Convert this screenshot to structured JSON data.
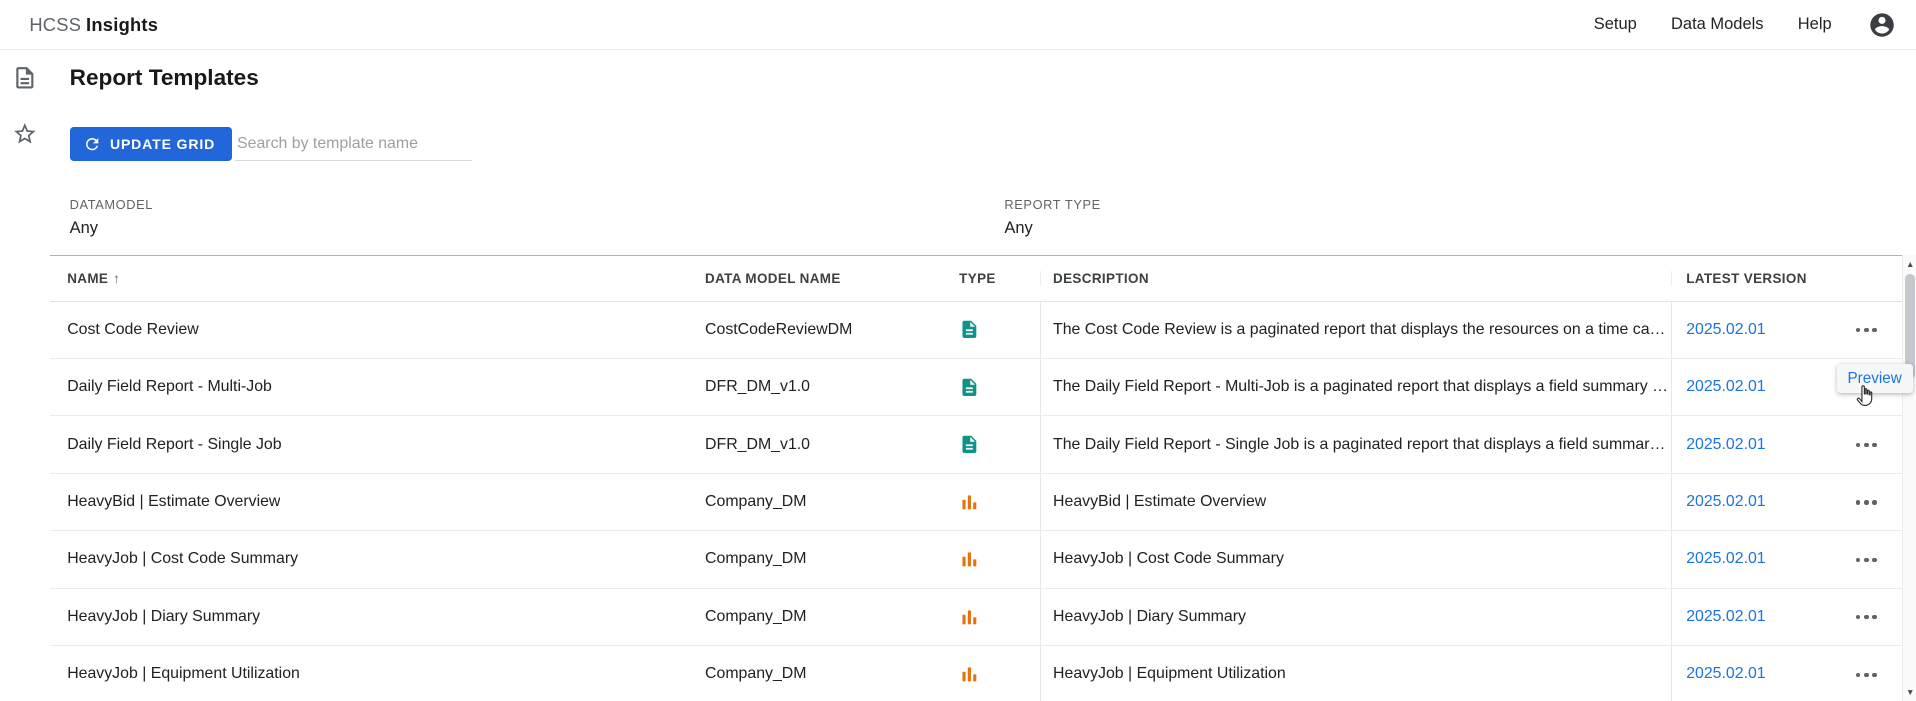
{
  "colors": {
    "primary_button": "#2167d9",
    "link": "#1a73e8",
    "report_icon": "#0d9488",
    "chart_icon": "#e8710a"
  },
  "header": {
    "brand_prefix": "HCSS",
    "brand_bold": "Insights",
    "nav": [
      {
        "label": "Setup"
      },
      {
        "label": "Data Models"
      },
      {
        "label": "Help"
      }
    ]
  },
  "page_title": "Report Templates",
  "toolbar": {
    "update_grid": "UPDATE GRID",
    "search_placeholder": "Search by template name",
    "search_value": ""
  },
  "filters": {
    "datamodel_label": "DATAMODEL",
    "datamodel_value": "Any",
    "report_type_label": "REPORT TYPE",
    "report_type_value": "Any"
  },
  "table": {
    "columns": {
      "name": "NAME",
      "data_model": "DATA MODEL NAME",
      "type": "TYPE",
      "description": "DESCRIPTION",
      "version": "LATEST VERSION"
    },
    "sort": {
      "column": "NAME",
      "direction": "ascending",
      "glyph": "↑"
    },
    "rows": [
      {
        "name": "Cost Code Review",
        "data_model": "CostCodeReviewDM",
        "type": "paginated-report",
        "description": "The Cost Code Review is a paginated report that displays the resources on a time card by j...",
        "version": "2025.02.01"
      },
      {
        "name": "Daily Field Report - Multi-Job",
        "data_model": "DFR_DM_v1.0",
        "type": "paginated-report",
        "description": "The Daily Field Report - Multi-Job is a paginated report that displays a field summary by Fo...",
        "version": "2025.02.01"
      },
      {
        "name": "Daily Field Report - Single Job",
        "data_model": "DFR_DM_v1.0",
        "type": "paginated-report",
        "description": "The Daily Field Report - Single Job is a paginated report that displays a field summary by J...",
        "version": "2025.02.01"
      },
      {
        "name": "HeavyBid | Estimate Overview",
        "data_model": "Company_DM",
        "type": "chart",
        "description": "HeavyBid | Estimate Overview",
        "version": "2025.02.01"
      },
      {
        "name": "HeavyJob | Cost Code Summary",
        "data_model": "Company_DM",
        "type": "chart",
        "description": "HeavyJob | Cost Code Summary",
        "version": "2025.02.01"
      },
      {
        "name": "HeavyJob | Diary Summary",
        "data_model": "Company_DM",
        "type": "chart",
        "description": "HeavyJob | Diary Summary",
        "version": "2025.02.01"
      },
      {
        "name": "HeavyJob | Equipment Utilization",
        "data_model": "Company_DM",
        "type": "chart",
        "description": "HeavyJob | Equipment Utilization",
        "version": "2025.02.01"
      }
    ]
  },
  "context_menu": {
    "preview_label": "Preview"
  },
  "icons": {
    "rail": [
      "report-templates-icon",
      "favorites-star-icon"
    ],
    "button": "refresh-icon",
    "row_types": {
      "paginated-report": "document-report-icon",
      "chart": "bar-chart-icon"
    },
    "row_actions": "more-options-ellipsis-icon",
    "account": "account-circle-icon"
  }
}
